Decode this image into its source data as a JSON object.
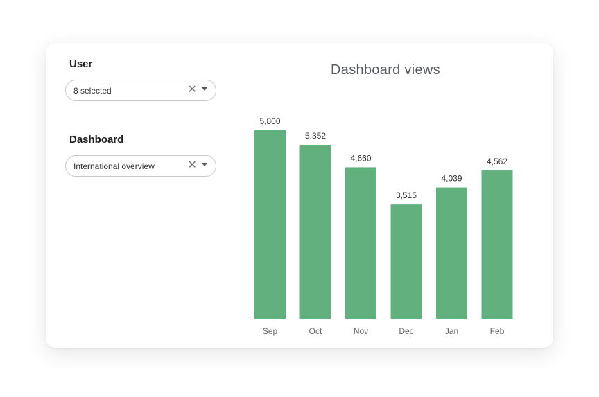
{
  "filters": {
    "user": {
      "label": "User",
      "value": "8 selected"
    },
    "dashboard": {
      "label": "Dashboard",
      "value": "International overview"
    }
  },
  "icons": {
    "clear": "close-icon",
    "dropdown": "caret-down-icon"
  },
  "colors": {
    "bar": "#62b07e",
    "axis": "#cccccc"
  },
  "chart_data": {
    "type": "bar",
    "title": "Dashboard views",
    "categories": [
      "Sep",
      "Oct",
      "Nov",
      "Dec",
      "Jan",
      "Feb"
    ],
    "values": [
      5800,
      5352,
      4660,
      3515,
      4039,
      4562
    ],
    "value_labels": [
      "5,800",
      "5,352",
      "4,660",
      "3,515",
      "4,039",
      "4,562"
    ],
    "xlabel": "",
    "ylabel": "",
    "ylim": [
      0,
      5800
    ],
    "grid": false,
    "legend": "none"
  }
}
